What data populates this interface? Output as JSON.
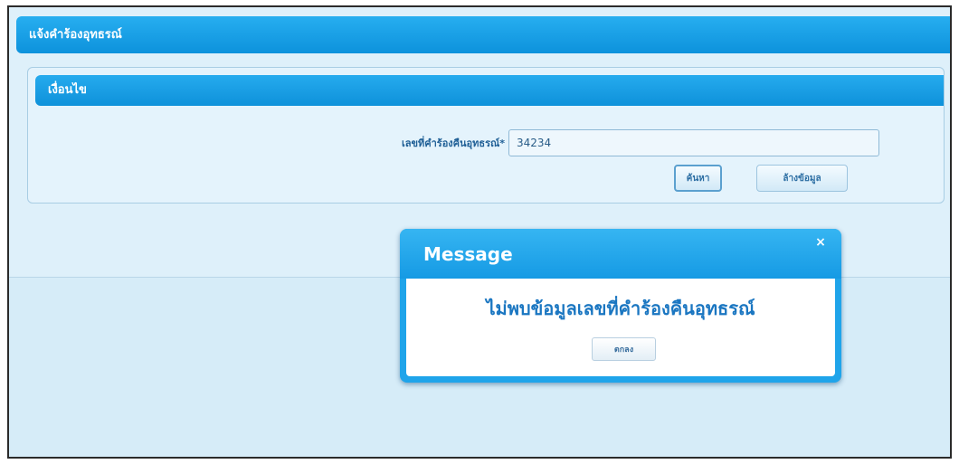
{
  "header": {
    "title": "แจ้งคำร้องอุทธรณ์"
  },
  "search_panel": {
    "title": "เงื่อนไข",
    "field_label": "เลขที่คำร้องคืนอุทธรณ์*",
    "field_value": "34234",
    "search_button": "ค้นหา",
    "clear_button": "ล้างข้อมูล"
  },
  "modal": {
    "title": "Message",
    "close_glyph": "×",
    "message": "ไม่พบข้อมูลเลขที่คำร้องคืนอุทธรณ์",
    "ok_button": "ตกลง"
  },
  "colors": {
    "header_blue": "#0d92dc",
    "page_background": "#d6ecf8",
    "message_text": "#1a76c1"
  },
  "icons": {
    "close": "close-icon"
  }
}
